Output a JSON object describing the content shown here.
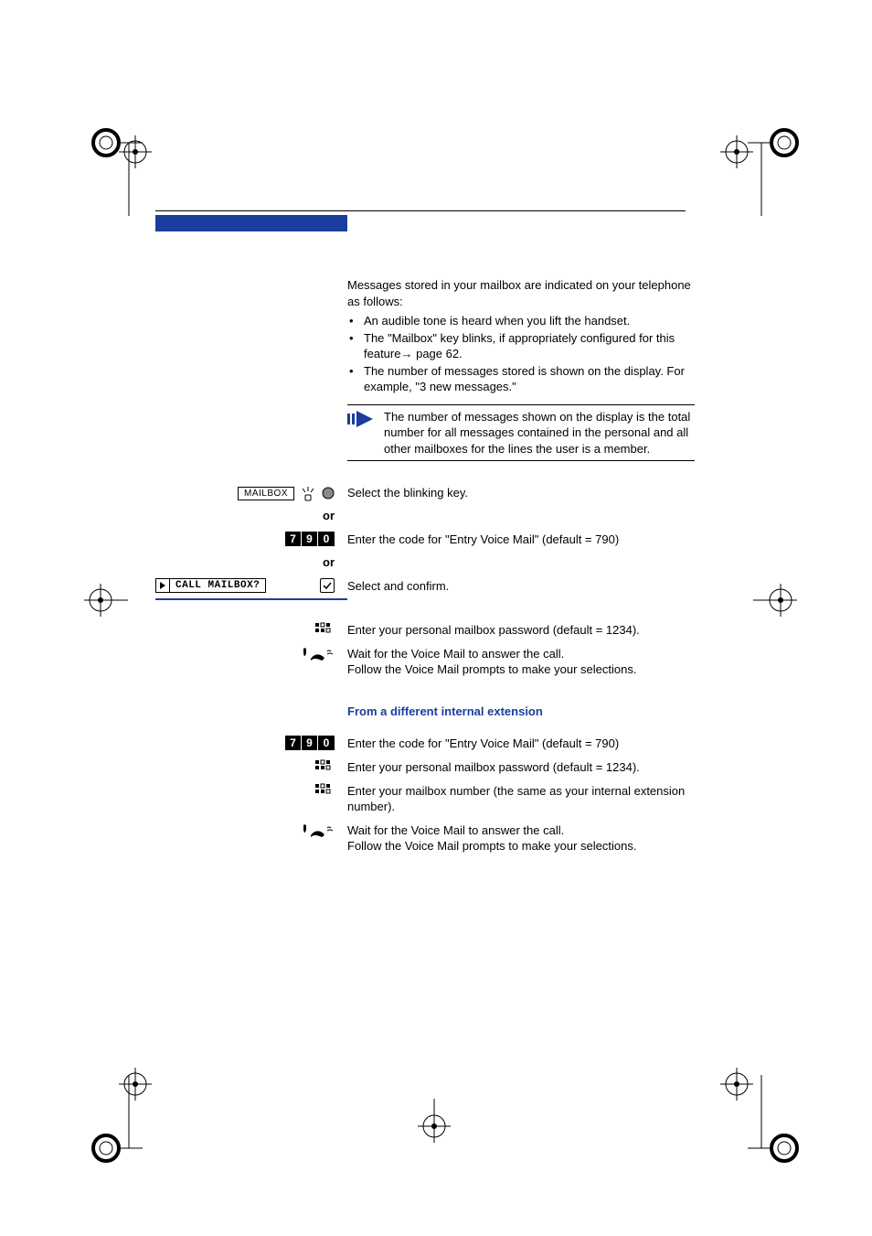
{
  "intro": "Messages stored in your mailbox are indicated on your telephone as follows:",
  "bullets": [
    "An audible tone is heard when you lift the handset.",
    "The \"Mailbox\" key blinks, if appropriately configured for this feature",
    "The number of messages stored is shown on the display. For example, \"3 new messages.\""
  ],
  "bullet_page_ref": " page 62.",
  "note": "The number of messages shown on the display is the total number for all messages contained in the personal and all other mailboxes for the lines the user is a member.",
  "mailbox_key_label": "MAILBOX",
  "select_blinking": "Select the blinking key.",
  "or_label": "or",
  "code_790": {
    "d1": "7",
    "d2": "9",
    "d3": "0"
  },
  "enter_code_790": "Enter the code for \"Entry Voice Mail\" (default = 790)",
  "call_mailbox_display": "CALL MAILBOX?",
  "select_confirm": "Select and confirm.",
  "enter_password_1234": "Enter your personal mailbox password (default = 1234).",
  "wait_answer": "Wait for the Voice Mail to answer the call.",
  "follow_prompts": "Follow the Voice Mail prompts to make your selections.",
  "diff_ext_heading": "From a different internal extension",
  "enter_mailbox_number": "Enter your mailbox number (the same as your internal extension number)."
}
